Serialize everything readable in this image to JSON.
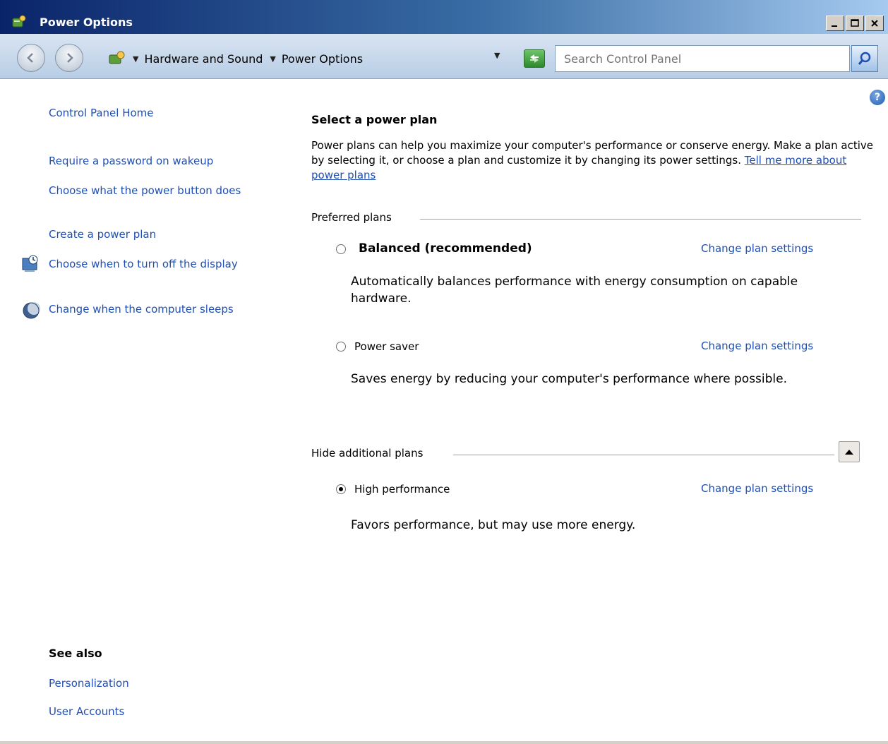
{
  "window": {
    "title": "Power Options",
    "minimize_label": "_",
    "maximize_label": "□",
    "close_label": "✕"
  },
  "address_bar": {
    "breadcrumbs": [
      "Hardware and Sound",
      "Power Options"
    ],
    "search_placeholder": "Search Control Panel"
  },
  "help_label": "?",
  "sidebar": {
    "home": "Control Panel Home",
    "items": [
      "Require a password on wakeup",
      "Choose what the power button does",
      "Create a power plan",
      "Choose when to turn off the display",
      "Change when the computer sleeps"
    ],
    "see_also_title": "See also",
    "see_also": [
      "Personalization",
      "User Accounts"
    ]
  },
  "main": {
    "heading": "Select a power plan",
    "intro": "Power plans can help you maximize your computer's performance or conserve energy. Make a plan active by selecting it, or choose a plan and customize it by changing its power settings.",
    "intro_link": "Tell me more about power plans",
    "preferred_label": "Preferred plans",
    "additional_label": "Hide additional plans",
    "change_link": "Change plan settings",
    "plans": [
      {
        "name": "Balanced (recommended)",
        "description": "Automatically balances performance with energy consumption on capable hardware.",
        "selected": false
      },
      {
        "name": "Power saver",
        "description": "Saves energy by reducing your computer's performance where possible.",
        "selected": false
      },
      {
        "name": "High performance",
        "description": "Favors performance, but may use more energy.",
        "selected": true
      }
    ]
  }
}
